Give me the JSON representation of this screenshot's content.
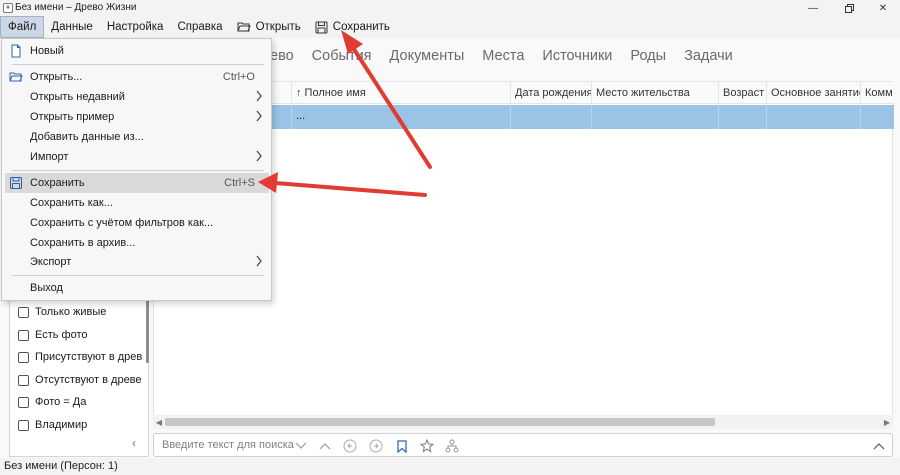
{
  "window": {
    "title": "Без имени – Древо Жизни"
  },
  "menubar": {
    "file": "Файл",
    "data": "Данные",
    "settings": "Настройка",
    "help": "Справка",
    "open": "Открыть",
    "save": "Сохранить"
  },
  "tabs": [
    "ево",
    "События",
    "Документы",
    "Места",
    "Источники",
    "Роды",
    "Задачи"
  ],
  "table": {
    "columns": [
      "↑ Полное имя",
      "Дата рождения",
      "Место жительства",
      "Возраст",
      "Основное занятие",
      "Комм"
    ],
    "row": {
      "name": "..."
    }
  },
  "search": {
    "placeholder": "Введите текст для поиска"
  },
  "filters": [
    {
      "label": "Только живые"
    },
    {
      "label": "Есть фото"
    },
    {
      "label": "Присутствуют в древ"
    },
    {
      "label": "Отсутствуют в древе"
    },
    {
      "label": "Фото = Да"
    },
    {
      "label": "Владимир"
    }
  ],
  "status": {
    "text": "Без имени (Персон: 1)"
  },
  "file_menu": {
    "new": "Новый",
    "open": "Открыть...",
    "open_shortcut": "Ctrl+O",
    "open_recent": "Открыть недавний",
    "open_sample": "Открыть пример",
    "add_data": "Добавить данные из...",
    "import": "Импорт",
    "save": "Сохранить",
    "save_shortcut": "Ctrl+S",
    "save_as": "Сохранить как...",
    "save_filtered": "Сохранить с учётом фильтров как...",
    "save_archive": "Сохранить в архив...",
    "export": "Экспорт",
    "exit": "Выход"
  },
  "colors": {
    "selected_row": "#9ac3e6",
    "annotation_arrow": "#e03c31",
    "menu_active": "#ccd6e4"
  }
}
